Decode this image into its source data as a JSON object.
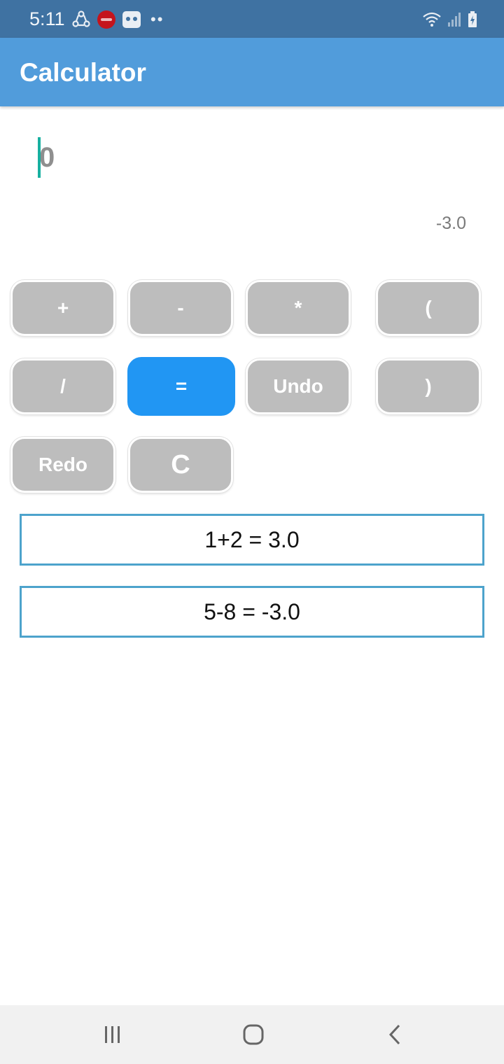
{
  "status_bar": {
    "time": "5:11",
    "left_icons": [
      "share-icon",
      "red-badge-icon",
      "robot-icon",
      "more-dots-icon"
    ],
    "right_icons": [
      "wifi-icon",
      "signal-icon",
      "battery-icon"
    ]
  },
  "app_bar": {
    "title": "Calculator"
  },
  "display": {
    "input_value": "",
    "input_placeholder": "0",
    "result": "-3.0"
  },
  "keypad": {
    "buttons": [
      "+",
      "-",
      "*",
      "(",
      "/",
      "=",
      "Undo",
      ")",
      "Redo",
      "C"
    ]
  },
  "history": [
    {
      "text": "1+2 = 3.0"
    },
    {
      "text": "5-8 = -3.0"
    }
  ],
  "colors": {
    "status_bar": "#3f72a2",
    "app_bar": "#519cdb",
    "button": "#bdbdbd",
    "equals_button": "#2196f3",
    "history_border": "#4da3cc",
    "cursor": "#17b0a0"
  },
  "nav_bar": {
    "icons": [
      "recent-apps-icon",
      "home-icon",
      "back-icon"
    ]
  }
}
